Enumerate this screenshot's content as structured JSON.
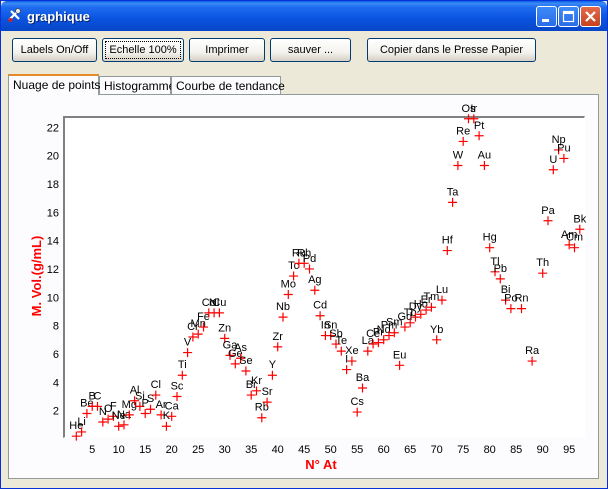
{
  "window": {
    "title": "graphique",
    "buttons": {
      "minimize": "minimize-icon",
      "maximize": "maximize-icon",
      "close": "close-icon"
    }
  },
  "toolbar": {
    "labels_toggle": "Labels On/Off",
    "scale": "Echelle 100%",
    "print": "Imprimer",
    "save": "sauver ...",
    "copy": "Copier dans le Presse Papier"
  },
  "tabs": [
    {
      "label": "Nuage de points",
      "active": true
    },
    {
      "label": "Histogramme",
      "active": false
    },
    {
      "label": "Courbe de tendance",
      "active": false
    }
  ],
  "colors": {
    "marker": "#ff0000",
    "axis_label": "#ff0000",
    "accent": "#e68b2c"
  },
  "chart_data": {
    "type": "scatter",
    "title": "",
    "xlabel": "N° At",
    "ylabel": "M. Vol.(g/mL)",
    "xlim": [
      1,
      96
    ],
    "ylim": [
      0,
      23
    ],
    "x_ticks": [
      5,
      10,
      15,
      20,
      25,
      30,
      35,
      40,
      45,
      50,
      55,
      60,
      65,
      70,
      75,
      80,
      85,
      90,
      95
    ],
    "y_ticks": [
      2,
      4,
      6,
      8,
      10,
      12,
      14,
      16,
      18,
      20,
      22
    ],
    "grid": false,
    "marker": "+",
    "points": [
      {
        "z": 2,
        "v": 0.2,
        "label": "He"
      },
      {
        "z": 3,
        "v": 0.5,
        "label": "Li"
      },
      {
        "z": 4,
        "v": 1.8,
        "label": "Be"
      },
      {
        "z": 5,
        "v": 2.3,
        "label": "B"
      },
      {
        "z": 6,
        "v": 2.3,
        "label": "C"
      },
      {
        "z": 7,
        "v": 1.2,
        "label": "N"
      },
      {
        "z": 8,
        "v": 1.4,
        "label": "O"
      },
      {
        "z": 9,
        "v": 1.6,
        "label": "F"
      },
      {
        "z": 10,
        "v": 0.9,
        "label": "Ne"
      },
      {
        "z": 11,
        "v": 1.0,
        "label": "Na"
      },
      {
        "z": 12,
        "v": 1.7,
        "label": "Mg"
      },
      {
        "z": 13,
        "v": 2.7,
        "label": "Al"
      },
      {
        "z": 14,
        "v": 2.3,
        "label": "Si"
      },
      {
        "z": 15,
        "v": 1.8,
        "label": "P"
      },
      {
        "z": 16,
        "v": 2.1,
        "label": "S"
      },
      {
        "z": 17,
        "v": 3.1,
        "label": "Cl"
      },
      {
        "z": 18,
        "v": 1.7,
        "label": "Ar"
      },
      {
        "z": 19,
        "v": 0.9,
        "label": "K"
      },
      {
        "z": 20,
        "v": 1.6,
        "label": "Ca"
      },
      {
        "z": 21,
        "v": 3.0,
        "label": "Sc"
      },
      {
        "z": 22,
        "v": 4.5,
        "label": "Ti"
      },
      {
        "z": 23,
        "v": 6.1,
        "label": "V"
      },
      {
        "z": 24,
        "v": 7.2,
        "label": "Cr"
      },
      {
        "z": 25,
        "v": 7.4,
        "label": "Mn"
      },
      {
        "z": 26,
        "v": 7.9,
        "label": "Fe"
      },
      {
        "z": 27,
        "v": 8.9,
        "label": "Co"
      },
      {
        "z": 28,
        "v": 8.9,
        "label": "Ni"
      },
      {
        "z": 29,
        "v": 8.9,
        "label": "Cu"
      },
      {
        "z": 30,
        "v": 7.1,
        "label": "Zn"
      },
      {
        "z": 31,
        "v": 5.9,
        "label": "Ga"
      },
      {
        "z": 32,
        "v": 5.3,
        "label": "Ge"
      },
      {
        "z": 33,
        "v": 5.7,
        "label": "As"
      },
      {
        "z": 34,
        "v": 4.8,
        "label": "Se"
      },
      {
        "z": 35,
        "v": 3.1,
        "label": "Br"
      },
      {
        "z": 36,
        "v": 3.4,
        "label": "Kr"
      },
      {
        "z": 37,
        "v": 1.5,
        "label": "Rb"
      },
      {
        "z": 38,
        "v": 2.6,
        "label": "Sr"
      },
      {
        "z": 39,
        "v": 4.5,
        "label": "Y"
      },
      {
        "z": 40,
        "v": 6.5,
        "label": "Zr"
      },
      {
        "z": 41,
        "v": 8.6,
        "label": "Nb"
      },
      {
        "z": 42,
        "v": 10.2,
        "label": "Mo"
      },
      {
        "z": 43,
        "v": 11.5,
        "label": "Tc"
      },
      {
        "z": 44,
        "v": 12.4,
        "label": "Ru"
      },
      {
        "z": 45,
        "v": 12.4,
        "label": "Rh"
      },
      {
        "z": 46,
        "v": 12.0,
        "label": "Pd"
      },
      {
        "z": 47,
        "v": 10.5,
        "label": "Ag"
      },
      {
        "z": 48,
        "v": 8.7,
        "label": "Cd"
      },
      {
        "z": 49,
        "v": 7.3,
        "label": "In"
      },
      {
        "z": 50,
        "v": 7.3,
        "label": "Sn"
      },
      {
        "z": 51,
        "v": 6.7,
        "label": "Sb"
      },
      {
        "z": 52,
        "v": 6.2,
        "label": "Te"
      },
      {
        "z": 53,
        "v": 4.9,
        "label": "I"
      },
      {
        "z": 54,
        "v": 5.5,
        "label": "Xe"
      },
      {
        "z": 55,
        "v": 1.9,
        "label": "Cs"
      },
      {
        "z": 56,
        "v": 3.6,
        "label": "Ba"
      },
      {
        "z": 57,
        "v": 6.2,
        "label": "La"
      },
      {
        "z": 58,
        "v": 6.7,
        "label": "Ce"
      },
      {
        "z": 59,
        "v": 6.8,
        "label": "Pr"
      },
      {
        "z": 60,
        "v": 7.0,
        "label": "Nd"
      },
      {
        "z": 61,
        "v": 7.3,
        "label": "Pm"
      },
      {
        "z": 62,
        "v": 7.5,
        "label": "Sm"
      },
      {
        "z": 63,
        "v": 5.2,
        "label": "Eu"
      },
      {
        "z": 64,
        "v": 7.9,
        "label": "Gd"
      },
      {
        "z": 65,
        "v": 8.2,
        "label": "Tb"
      },
      {
        "z": 66,
        "v": 8.6,
        "label": "Dy"
      },
      {
        "z": 67,
        "v": 8.8,
        "label": "Ho"
      },
      {
        "z": 68,
        "v": 9.1,
        "label": "Er"
      },
      {
        "z": 69,
        "v": 9.3,
        "label": "Tm"
      },
      {
        "z": 70,
        "v": 7.0,
        "label": "Yb"
      },
      {
        "z": 71,
        "v": 9.8,
        "label": "Lu"
      },
      {
        "z": 72,
        "v": 13.3,
        "label": "Hf"
      },
      {
        "z": 73,
        "v": 16.7,
        "label": "Ta"
      },
      {
        "z": 74,
        "v": 19.3,
        "label": "W"
      },
      {
        "z": 75,
        "v": 21.0,
        "label": "Re"
      },
      {
        "z": 76,
        "v": 22.6,
        "label": "Os"
      },
      {
        "z": 77,
        "v": 22.6,
        "label": "Ir"
      },
      {
        "z": 78,
        "v": 21.4,
        "label": "Pt"
      },
      {
        "z": 79,
        "v": 19.3,
        "label": "Au"
      },
      {
        "z": 80,
        "v": 13.5,
        "label": "Hg"
      },
      {
        "z": 81,
        "v": 11.8,
        "label": "Tl"
      },
      {
        "z": 82,
        "v": 11.3,
        "label": "Pb"
      },
      {
        "z": 83,
        "v": 9.8,
        "label": "Bi"
      },
      {
        "z": 84,
        "v": 9.2,
        "label": "Po"
      },
      {
        "z": 86,
        "v": 9.2,
        "label": "Rn"
      },
      {
        "z": 88,
        "v": 5.5,
        "label": "Ra"
      },
      {
        "z": 90,
        "v": 11.7,
        "label": "Th"
      },
      {
        "z": 91,
        "v": 15.4,
        "label": "Pa"
      },
      {
        "z": 92,
        "v": 19.0,
        "label": "U"
      },
      {
        "z": 93,
        "v": 20.4,
        "label": "Np"
      },
      {
        "z": 94,
        "v": 19.8,
        "label": "Pu"
      },
      {
        "z": 95,
        "v": 13.7,
        "label": "Am"
      },
      {
        "z": 96,
        "v": 13.5,
        "label": "Cm"
      },
      {
        "z": 97,
        "v": 14.8,
        "label": "Bk"
      }
    ]
  }
}
